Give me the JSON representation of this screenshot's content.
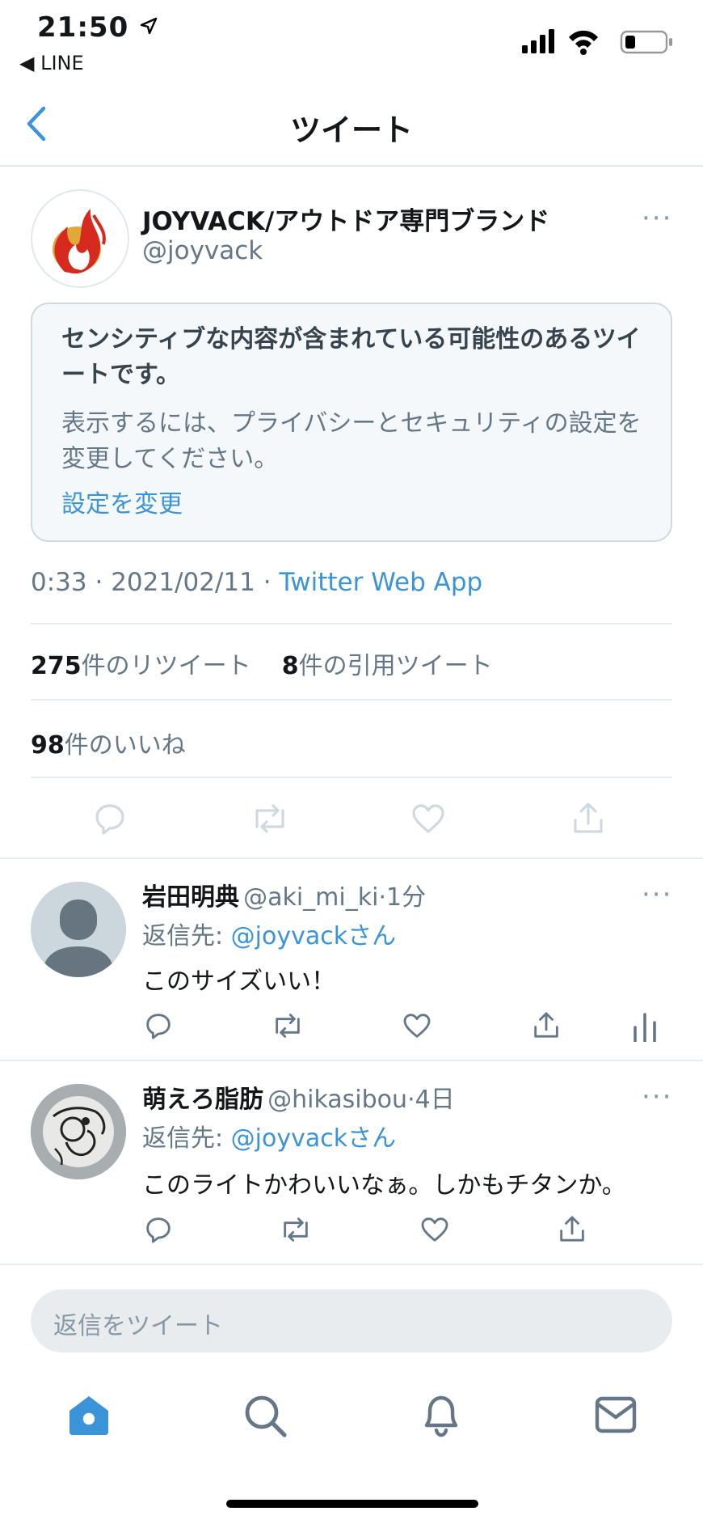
{
  "status": {
    "time": "21:50",
    "back_app": "LINE"
  },
  "nav": {
    "title": "ツイート"
  },
  "tweet": {
    "author_name": "JOYVACK/アウトドア専門ブランド",
    "author_handle": "@joyvack",
    "more": "···",
    "sensitive_title": "センシティブな内容が含まれている可能性のあるツイートです。",
    "sensitive_body": "表示するには、プライバシーとセキュリティの設定を変更してください。",
    "sensitive_link": "設定を変更",
    "time": "0:33",
    "date": "2021/02/11",
    "source": "Twitter Web App",
    "retweets_num": "275",
    "retweets_label": "件のリツイート",
    "quotes_num": "8",
    "quotes_label": "件の引用ツイート",
    "likes_num": "98",
    "likes_label": "件のいいね"
  },
  "replies": [
    {
      "name": "岩田明典",
      "handle": "@aki_mi_ki",
      "time": "1分",
      "reply_to_label": "返信先:",
      "reply_to": "@joyvackさん",
      "text": "このサイズいい！",
      "more": "···"
    },
    {
      "name": "萌えろ脂肪",
      "handle": "@hikasibou",
      "time": "4日",
      "reply_to_label": "返信先:",
      "reply_to": "@joyvackさん",
      "text": "このライトかわいいなぁ。しかもチタンか。",
      "more": "···"
    }
  ],
  "reply_input": {
    "placeholder": "返信をツイート"
  },
  "colors": {
    "accent": "#3a94d7",
    "secondary_text": "#657786",
    "divider": "#e6ecf0"
  },
  "icons": {
    "status": [
      "location-arrow-icon",
      "cellular-signal-icon",
      "wifi-icon",
      "battery-icon"
    ],
    "tab_bar": [
      "home-icon",
      "search-icon",
      "notifications-icon",
      "messages-icon"
    ],
    "actions": [
      "reply-icon",
      "retweet-icon",
      "like-icon",
      "share-icon",
      "analytics-icon"
    ]
  }
}
